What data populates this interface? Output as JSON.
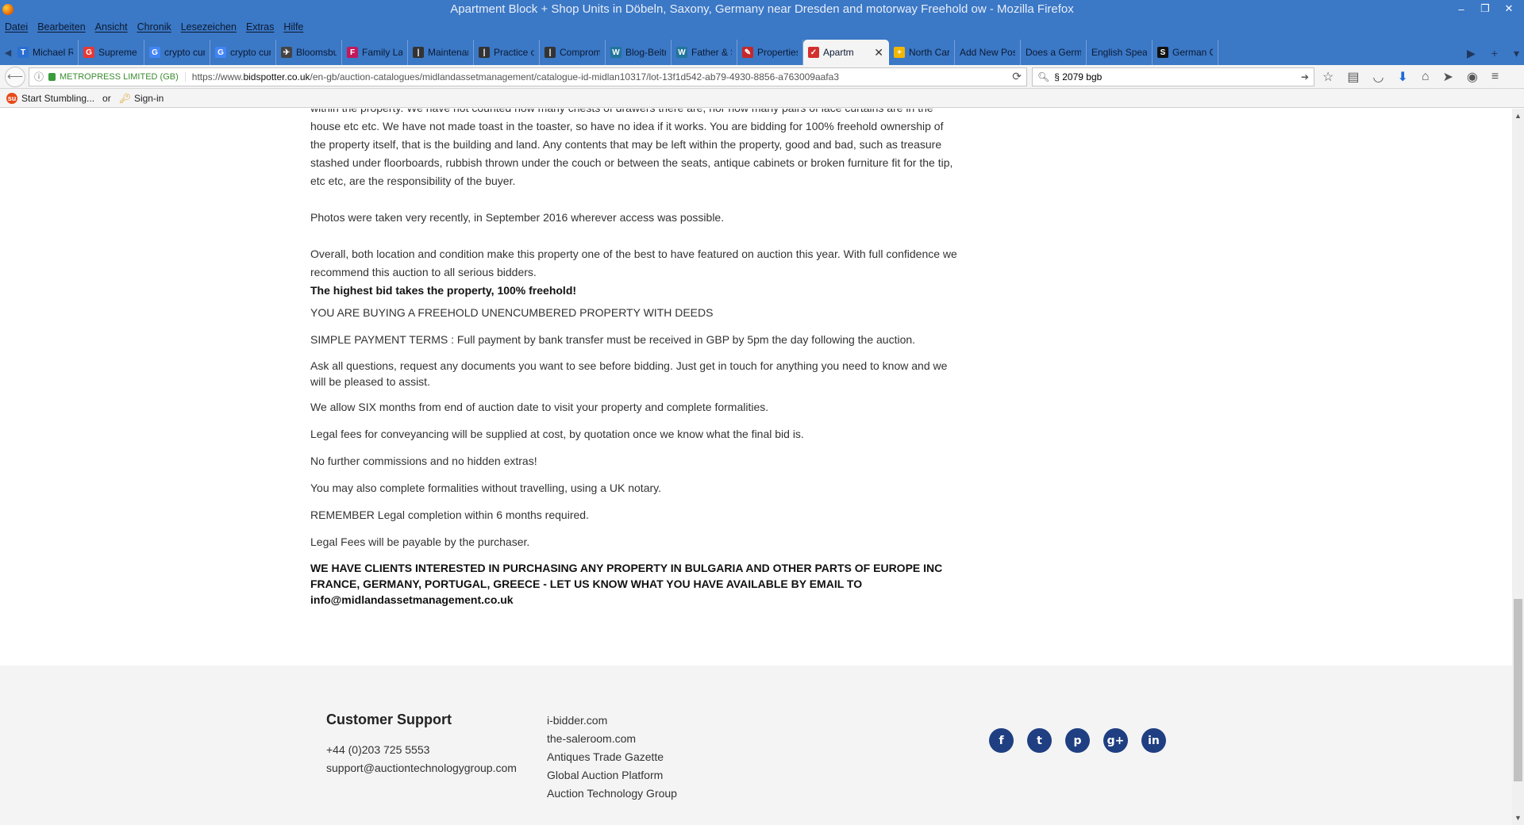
{
  "window": {
    "title": "Apartment Block + Shop Units in Döbeln, Saxony, Germany near Dresden and motorway   Freehold ow - Mozilla Firefox",
    "controls": [
      "–",
      "❐",
      "✕"
    ]
  },
  "menu": [
    "Datei",
    "Bearbeiten",
    "Ansicht",
    "Chronik",
    "Lesezeichen",
    "Extras",
    "Hilfe"
  ],
  "tabs": [
    {
      "label": "Michael R.",
      "icon": "T",
      "color": "#2a6fd1"
    },
    {
      "label": "Supreme C",
      "icon": "G",
      "color": "#e53935"
    },
    {
      "label": "crypto curr",
      "icon": "G",
      "color": "#4285f4"
    },
    {
      "label": "crypto curr",
      "icon": "G",
      "color": "#4285f4"
    },
    {
      "label": "Bloomsbur",
      "icon": "✈",
      "color": "#444"
    },
    {
      "label": "Family Law",
      "icon": "F",
      "color": "#c2185b"
    },
    {
      "label": "Maintenan",
      "icon": "|",
      "color": "#333"
    },
    {
      "label": "Practice of",
      "icon": "|",
      "color": "#333"
    },
    {
      "label": "Comprom",
      "icon": "|",
      "color": "#333"
    },
    {
      "label": "Blog-Beitr",
      "icon": "W",
      "color": "#21759b"
    },
    {
      "label": "Father & S",
      "icon": "W",
      "color": "#21759b"
    },
    {
      "label": "Properties",
      "icon": "✎",
      "color": "#c62828"
    },
    {
      "label": "Apartm",
      "icon": "✓",
      "color": "#d32f2f",
      "active": true
    },
    {
      "label": "North Caro",
      "icon": "+",
      "color": "#f2b600"
    },
    {
      "label": "Add New Post",
      "icon": "",
      "color": ""
    },
    {
      "label": "Does a German",
      "icon": "",
      "color": ""
    },
    {
      "label": "English Speakin",
      "icon": "",
      "color": ""
    },
    {
      "label": "German Cr",
      "icon": "S",
      "color": "#111"
    }
  ],
  "nav": {
    "identity": "METROPRESS LIMITED (GB)",
    "url_prefix": "https://www.",
    "url_domain": "bidspotter.co.uk",
    "url_path": "/en-gb/auction-catalogues/midlandassetmanagement/catalogue-id-midlan10317/lot-13f1d542-ab79-4930-8856-a763009aafa3",
    "search_value": "§ 2079 bgb"
  },
  "bookmarks": {
    "stumble": "Start Stumbling...",
    "or": "or",
    "signin": "Sign-in"
  },
  "article": {
    "para1": "within the property. We have not counted how many chests of drawers there are, nor how many pairs of lace curtains are in the house etc etc. We have not made toast in the toaster, so have no idea if it works. You are bidding for 100% freehold ownership of the property itself, that is the building and land. Any contents that may be left within the property, good and bad, such as treasure stashed under floorboards, rubbish thrown under the couch or between the seats, antique cabinets or broken furniture fit for the tip, etc etc, are the responsibility of the buyer.",
    "para2": "Photos were taken very recently, in September 2016 wherever access was possible.",
    "para3": "Overall, both location and condition make this property one of the best to have featured on auction this year. With full confidence we recommend this auction to all serious bidders.",
    "bold1": "The highest bid takes the property, 100% freehold!",
    "line1": "YOU ARE BUYING A FREEHOLD UNENCUMBERED PROPERTY WITH DEEDS",
    "line2": "SIMPLE PAYMENT TERMS : Full payment by bank transfer must be received in GBP by 5pm the day following the auction.",
    "line3": "Ask all questions, request any documents you want to see before bidding. Just get in touch for anything you need to know and we will be pleased to assist.",
    "line4": "We allow SIX months from end of auction date to visit your property and complete formalities.",
    "line5": "Legal fees for conveyancing will be supplied at cost, by quotation once we know what the final bid is.",
    "line6": "No further commissions and no hidden extras!",
    "line7": "You may also complete formalities without travelling, using a UK notary.",
    "line8": "REMEMBER Legal completion within 6 months required.",
    "line9": "Legal Fees will be payable by the purchaser.",
    "caps": "WE HAVE CLIENTS INTERESTED IN PURCHASING ANY PROPERTY IN BULGARIA AND OTHER PARTS OF EUROPE INC FRANCE, GERMANY, PORTUGAL, GREECE - LET US KNOW WHAT YOU HAVE AVAILABLE BY EMAIL TO info@midlandassetmanagement.co.uk"
  },
  "footer": {
    "support_title": "Customer Support",
    "phone": "+44 (0)203 725 5553",
    "email": "support@auctiontechnologygroup.com",
    "links": [
      "i-bidder.com",
      "the-saleroom.com",
      "Antiques Trade Gazette",
      "Global Auction Platform",
      "Auction Technology Group"
    ],
    "social": [
      "f",
      "t",
      "p",
      "g+",
      "in"
    ]
  }
}
